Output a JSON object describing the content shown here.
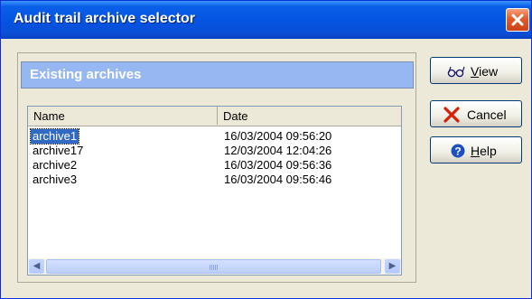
{
  "window": {
    "title": "Audit trail archive selector"
  },
  "panel": {
    "header": "Existing archives"
  },
  "list": {
    "columns": [
      "Name",
      "Date"
    ],
    "rows": [
      {
        "name": "archive1",
        "date": "16/03/2004 09:56:20",
        "selected": true
      },
      {
        "name": "archive17",
        "date": "12/03/2004 12:04:26",
        "selected": false
      },
      {
        "name": "archive2",
        "date": "16/03/2004 09:56:36",
        "selected": false
      },
      {
        "name": "archive3",
        "date": "16/03/2004 09:56:46",
        "selected": false
      }
    ]
  },
  "buttons": {
    "view": {
      "mnemonic": "V",
      "rest": "iew",
      "icon": "glasses-icon"
    },
    "cancel": {
      "label": "Cancel",
      "icon": "red-x-icon"
    },
    "help": {
      "mnemonic": "H",
      "rest": "elp",
      "icon": "help-question-icon"
    }
  },
  "colors": {
    "title_bar": "#0454e1",
    "panel_header": "#96b7f2",
    "selection": "#316ac5"
  }
}
